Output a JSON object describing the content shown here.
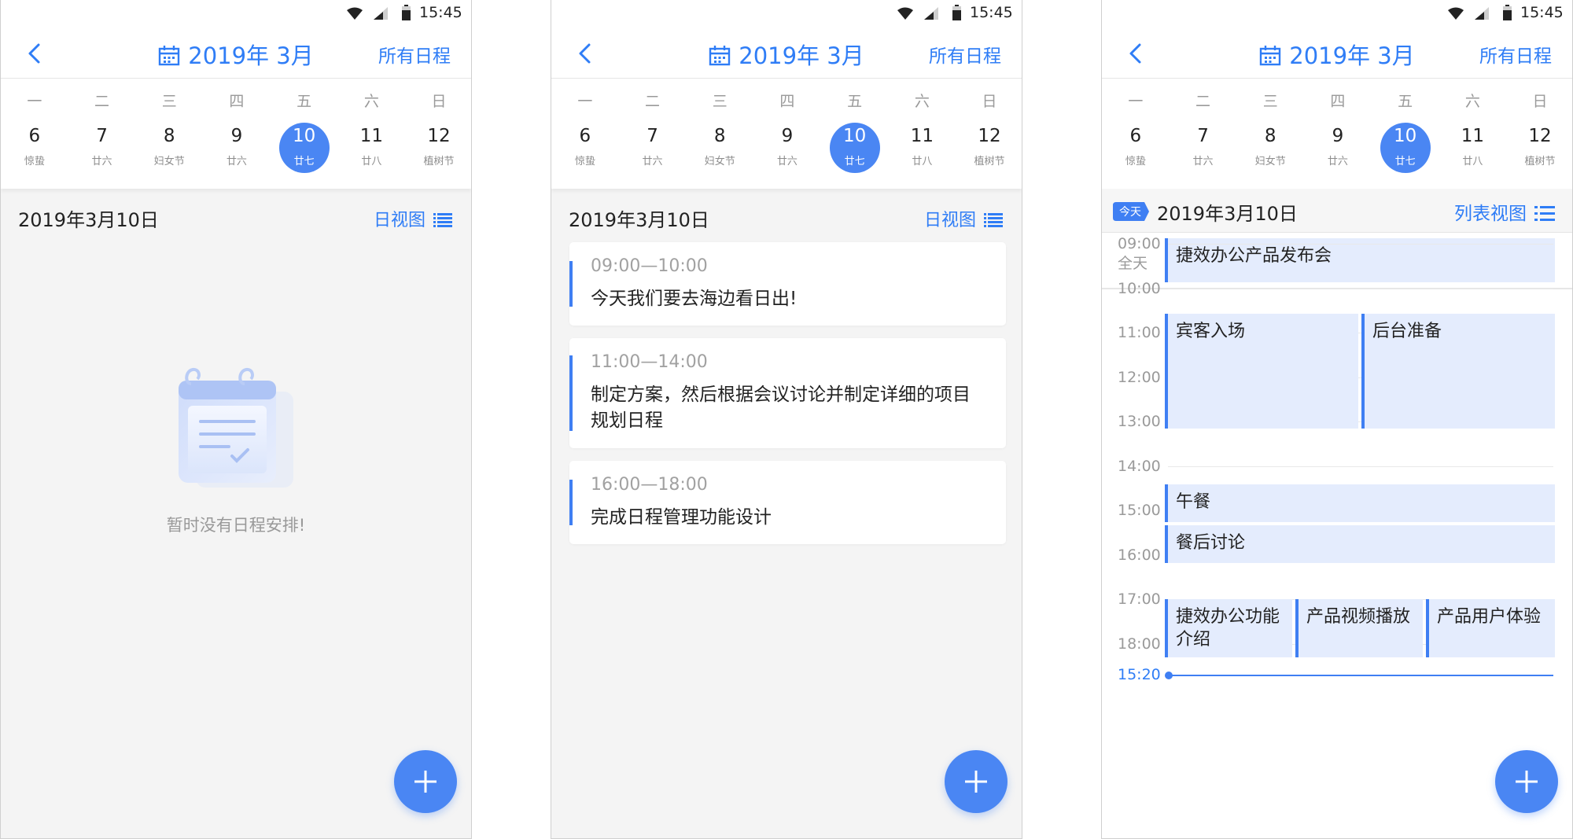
{
  "status_bar": {
    "time": "15:45"
  },
  "header": {
    "month": "2019年 3月",
    "all_label": "所有日程"
  },
  "week": {
    "day_labels": [
      "一",
      "二",
      "三",
      "四",
      "五",
      "六",
      "日"
    ],
    "days": [
      {
        "num": "6",
        "sub": "惊蛰"
      },
      {
        "num": "7",
        "sub": "廿六"
      },
      {
        "num": "8",
        "sub": "妇女节"
      },
      {
        "num": "9",
        "sub": "廿六"
      },
      {
        "num": "10",
        "sub": "廿七"
      },
      {
        "num": "11",
        "sub": "廿八"
      },
      {
        "num": "12",
        "sub": "植树节"
      }
    ],
    "selected_index": 4
  },
  "selected_date": "2019年3月10日",
  "day_view_label": "日视图",
  "list_view_label": "列表视图",
  "today_badge": "今天",
  "empty_message": "暂时没有日程安排!",
  "list_events": [
    {
      "time": "09:00—10:00",
      "title": "今天我们要去海边看日出!"
    },
    {
      "time": "11:00—14:00",
      "title": "制定方案，然后根据会议讨论并制定详细的项目规划日程"
    },
    {
      "time": "16:00—18:00",
      "title": "完成日程管理功能设计"
    }
  ],
  "day_view": {
    "all_day_label": "全天",
    "all_day_event": "捷效办公产品发布会",
    "hours": [
      "09:00",
      "10:00",
      "11:00",
      "12:00",
      "13:00",
      "14:00",
      "15:00",
      "16:00",
      "17:00",
      "18:00"
    ],
    "now": "15:20",
    "events": [
      "宾客入场",
      "后台准备",
      "午餐",
      "餐后讨论",
      "捷效办公功能介绍",
      "产品视频播放",
      "产品用户体验"
    ]
  },
  "colors": {
    "accent": "#2f7df6",
    "selected_circle": "#4a86f3",
    "event_bg": "#e4ecfd"
  }
}
